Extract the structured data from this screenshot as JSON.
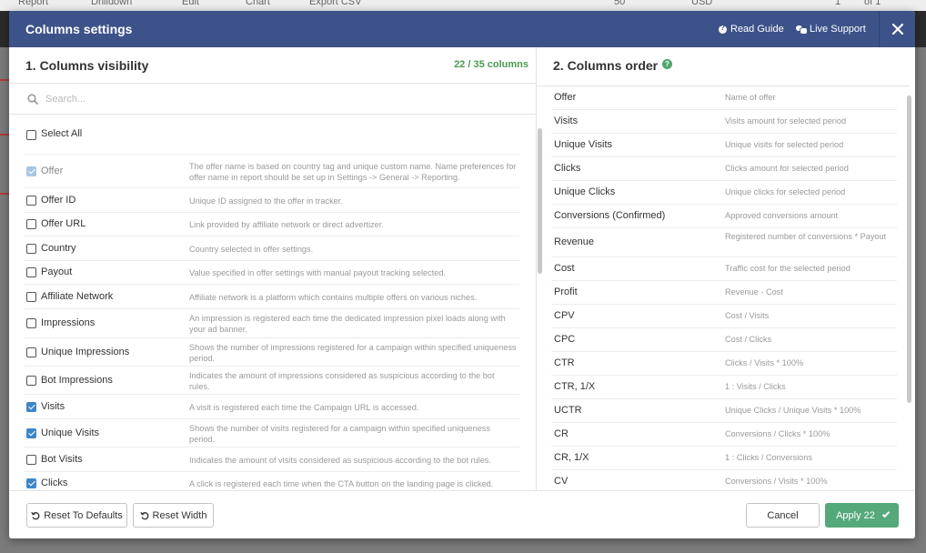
{
  "background_toolbar": {
    "items": [
      "Report",
      "Drilldown",
      "Edit",
      "Chart",
      "Export CSV"
    ],
    "per_page": "50",
    "currency": "USD",
    "page": "1",
    "page_of": "of 1"
  },
  "modal": {
    "title": "Columns settings",
    "read_guide": "Read Guide",
    "live_support": "Live Support"
  },
  "visibility": {
    "title": "1. Columns visibility",
    "counter": "22 / 35 columns",
    "search_placeholder": "Search...",
    "select_all": "Select All",
    "rows": [
      {
        "label": "Offer",
        "state": "disabled",
        "desc": "The offer name is based on country tag and unique custom name. Name preferences for offer name in report should be set up in Settings -> General -> Reporting."
      },
      {
        "label": "Offer ID",
        "state": "unchecked",
        "desc": "Unique ID assigned to the offer in tracker."
      },
      {
        "label": "Offer URL",
        "state": "unchecked",
        "desc": "Link provided by affiliate network or direct advertizer."
      },
      {
        "label": "Country",
        "state": "unchecked",
        "desc": "Country selected in offer settings."
      },
      {
        "label": "Payout",
        "state": "unchecked",
        "desc": "Value specified in offer settings with manual payout tracking selected."
      },
      {
        "label": "Affiliate Network",
        "state": "unchecked",
        "desc": "Affiliate network is a platform which contains multiple offers on various niches."
      },
      {
        "label": "Impressions",
        "state": "unchecked",
        "desc": "An impression is registered each time the dedicated impression pixel loads along with your ad banner."
      },
      {
        "label": "Unique Impressions",
        "state": "unchecked",
        "desc": "Shows the number of impressions registered for a campaign within specified uniqueness period."
      },
      {
        "label": "Bot Impressions",
        "state": "unchecked",
        "desc": "Indicates the amount of impressions considered as suspicious according to the bot rules."
      },
      {
        "label": "Visits",
        "state": "checked",
        "desc": "A visit is registered each time the Campaign URL is accessed."
      },
      {
        "label": "Unique Visits",
        "state": "checked",
        "desc": "Shows the number of visits registered for a campaign within specified uniqueness period."
      },
      {
        "label": "Bot Visits",
        "state": "unchecked",
        "desc": "Indicates the amount of visits considered as suspicious according to the bot rules."
      },
      {
        "label": "Clicks",
        "state": "checked",
        "desc": "A click is registered each time when the CTA button on the landing page is clicked."
      }
    ]
  },
  "order": {
    "title": "2. Columns order",
    "rows": [
      {
        "name": "Offer",
        "desc": "Name of offer"
      },
      {
        "name": "Visits",
        "desc": "Visits amount for selected period"
      },
      {
        "name": "Unique Visits",
        "desc": "Unique visits for selected period"
      },
      {
        "name": "Clicks",
        "desc": "Clicks amount for selected period"
      },
      {
        "name": "Unique Clicks",
        "desc": "Unique clicks for selected period"
      },
      {
        "name": "Conversions (Confirmed)",
        "desc": "Approved conversions amount"
      },
      {
        "name": "Revenue",
        "desc": "Registered number of conversions * Payout"
      },
      {
        "name": "Cost",
        "desc": "Traffic cost for the selected period"
      },
      {
        "name": "Profit",
        "desc": "Revenue - Cost"
      },
      {
        "name": "CPV",
        "desc": "Cost / Visits"
      },
      {
        "name": "CPC",
        "desc": "Cost / Clicks"
      },
      {
        "name": "CTR",
        "desc": "Clicks / Visits * 100%"
      },
      {
        "name": "CTR, 1/X",
        "desc": "1 : Visits / Clicks"
      },
      {
        "name": "UCTR",
        "desc": "Unique Clicks / Unique Visits * 100%"
      },
      {
        "name": "CR",
        "desc": "Conversions / Clicks * 100%"
      },
      {
        "name": "CR, 1/X",
        "desc": "1 : Clicks / Conversions"
      },
      {
        "name": "CV",
        "desc": "Conversions / Visits * 100%"
      }
    ]
  },
  "footer": {
    "reset_defaults": "Reset To Defaults",
    "reset_width": "Reset Width",
    "cancel": "Cancel",
    "apply": "Apply 22"
  },
  "colors": {
    "header": "#3c5289",
    "accent_green": "#55a87a",
    "checkbox_blue": "#3d86c6"
  }
}
